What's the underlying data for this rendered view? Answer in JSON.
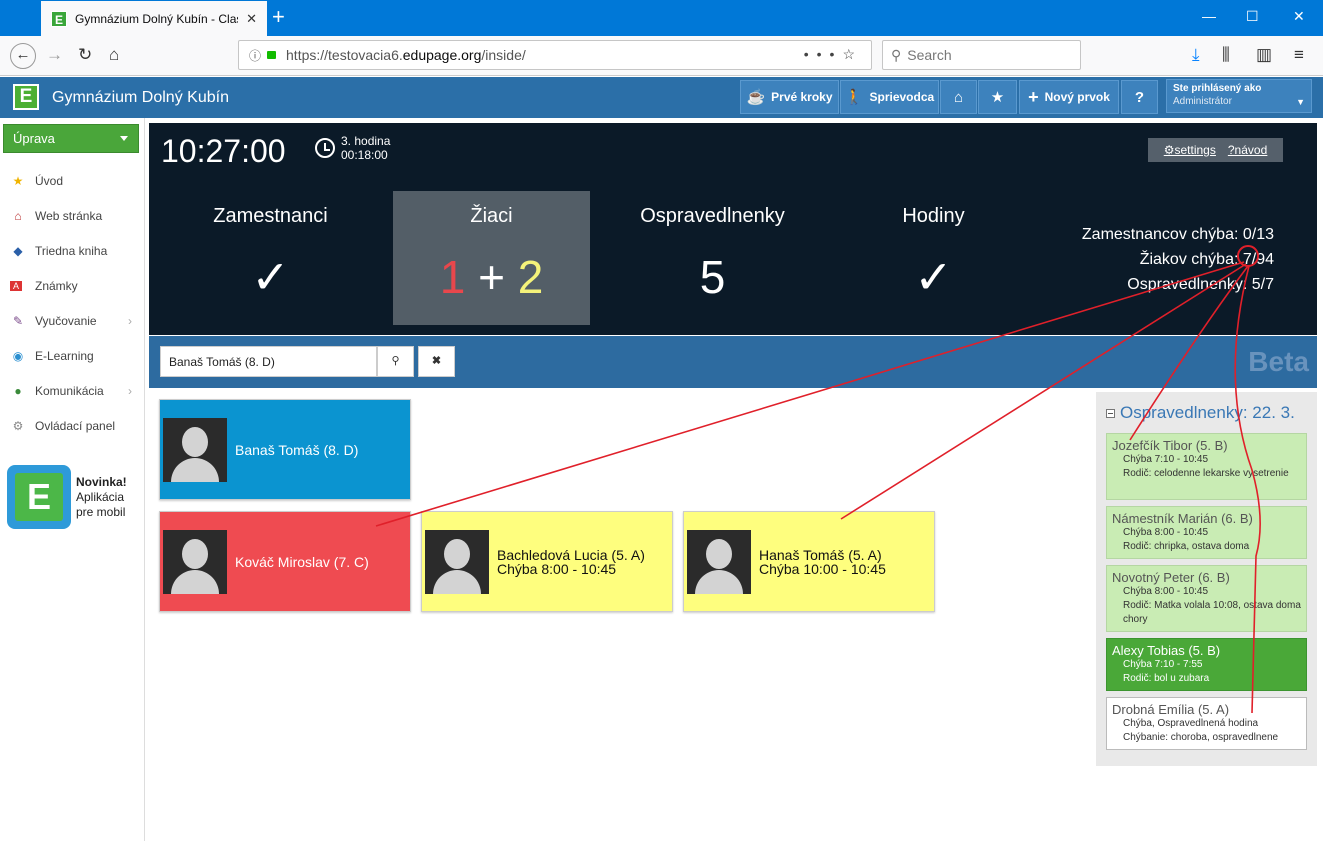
{
  "browser": {
    "tab_title": "Gymnázium Dolný Kubín - Class",
    "url_prefix": "https://testovacia6.",
    "url_host": "edupage.org",
    "url_path": "/inside/",
    "search_placeholder": "Search"
  },
  "header": {
    "logo": "E",
    "school_name": "Gymnázium Dolný Kubín",
    "buttons": [
      "Prvé kroky",
      "Sprievodca",
      "Nový prvok",
      "?"
    ],
    "user_line1": "Ste prihlásený ako",
    "user_line2": "Administrátor"
  },
  "sidebar": {
    "uprava": "Úprava",
    "items": [
      {
        "label": "Úvod",
        "icon": "star-icon"
      },
      {
        "label": "Web stránka",
        "icon": "web-icon"
      },
      {
        "label": "Triedna kniha",
        "icon": "book-icon"
      },
      {
        "label": "Známky",
        "icon": "grades-icon"
      },
      {
        "label": "Vyučovanie",
        "icon": "teaching-icon"
      },
      {
        "label": "E-Learning",
        "icon": "elearning-icon"
      },
      {
        "label": "Komunikácia",
        "icon": "communication-icon"
      },
      {
        "label": "Ovládací panel",
        "icon": "control-panel-icon"
      }
    ],
    "promo": {
      "title": "Novinka!",
      "line1": "Aplikácia",
      "line2": "pre mobil"
    }
  },
  "dashboard": {
    "clock": "10:27:00",
    "period": "3. hodina",
    "period_time": "00:18:00",
    "settings_label": "settings",
    "help_label": "návod",
    "stats": [
      {
        "label": "Zamestnanci",
        "value": "✓"
      },
      {
        "label": "Žiaci",
        "value_a": "1",
        "plus": "+",
        "value_b": "2"
      },
      {
        "label": "Ospravedlnenky",
        "value": "5"
      },
      {
        "label": "Hodiny",
        "value": "✓"
      }
    ],
    "summary": [
      "Zamestnancov chýba: 0/13",
      "Žiakov chýba: 7/94",
      "Ospravedlnenky: 5/7"
    ]
  },
  "search": {
    "value": "Banaš Tomáš (8. D)",
    "beta": "Beta"
  },
  "cards": [
    {
      "line1": "Banaš Tomáš (8. D)",
      "line2": "",
      "color": "#0b94d0"
    },
    {
      "line1": "Kováč Miroslav (7. C)",
      "line2": "",
      "color": "#ef4b51"
    },
    {
      "line1": "Bachledová Lucia (5. A)",
      "line2": "Chýba 8:00 - 10:45",
      "color": "#fefe7e"
    },
    {
      "line1": "Hanaš Tomáš (5. A)",
      "line2": "Chýba 10:00 - 10:45",
      "color": "#fefe7e"
    }
  ],
  "excuses": {
    "title": "Ospravedlnenky: 22. 3.",
    "items": [
      {
        "name": "Jozefčík Tibor (5. B)",
        "line1": "Chýba 7:10 - 10:45",
        "line2": "Rodič: celodenne lekarske vysetrenie"
      },
      {
        "name": "Námestník Marián (6. B)",
        "line1": "Chýba 8:00 - 10:45",
        "line2": "Rodič: chripka, ostava doma"
      },
      {
        "name": "Novotný Peter (6. B)",
        "line1": "Chýba 8:00 - 10:45",
        "line2": "Rodič: Matka volala 10:08, ostava doma chory"
      },
      {
        "name": "Alexy Tobias (5. B)",
        "line1": "Chýba 7:10 - 7:55",
        "line2": "Rodič: bol u zubara"
      },
      {
        "name": "Drobná Emília (5. A)",
        "line1": "Chýba, Ospravedlnená hodina",
        "line2": "Chýbanie: choroba, ospravedlnene"
      }
    ]
  },
  "colors": {
    "accent": "#2b6fa8",
    "red_annotation": "#e0202a",
    "green": "#4aa63a"
  }
}
